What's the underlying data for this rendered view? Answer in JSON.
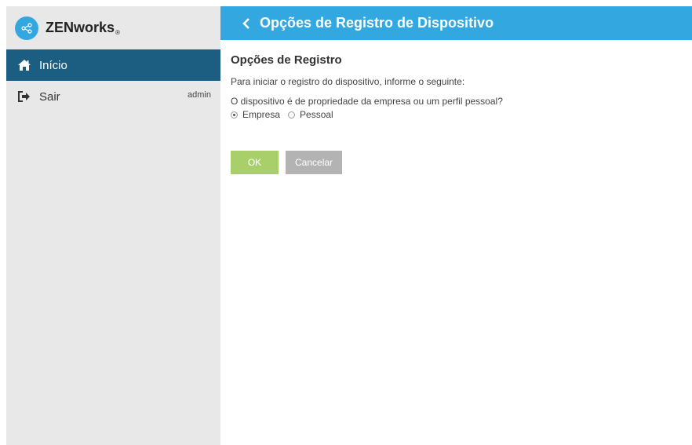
{
  "colors": {
    "header_bg": "#33a8e0",
    "nav_active_bg": "#1b5e82",
    "sidebar_bg": "#e8e8e8",
    "ok_button": "#a9cf6b",
    "cancel_button": "#b3b3b3"
  },
  "brand": {
    "name": "ZENworks",
    "registered": "®",
    "icon": "share-nodes-icon"
  },
  "sidebar": {
    "items": [
      {
        "label": "Início",
        "icon": "home-icon",
        "active": true
      },
      {
        "label": "Sair",
        "icon": "sign-out-icon",
        "user": "admin"
      }
    ]
  },
  "header": {
    "back_icon": "chevron-left-icon",
    "title": "Opções de Registro de Dispositivo"
  },
  "main": {
    "section_title": "Opções de Registro",
    "intro": "Para iniciar o registro do dispositivo, informe o seguinte:",
    "question": "O dispositivo é de propriedade da empresa ou um perfil pessoal?",
    "options": [
      {
        "label": "Empresa",
        "selected": true
      },
      {
        "label": "Pessoal",
        "selected": false
      }
    ],
    "ok_label": "OK",
    "cancel_label": "Cancelar"
  }
}
